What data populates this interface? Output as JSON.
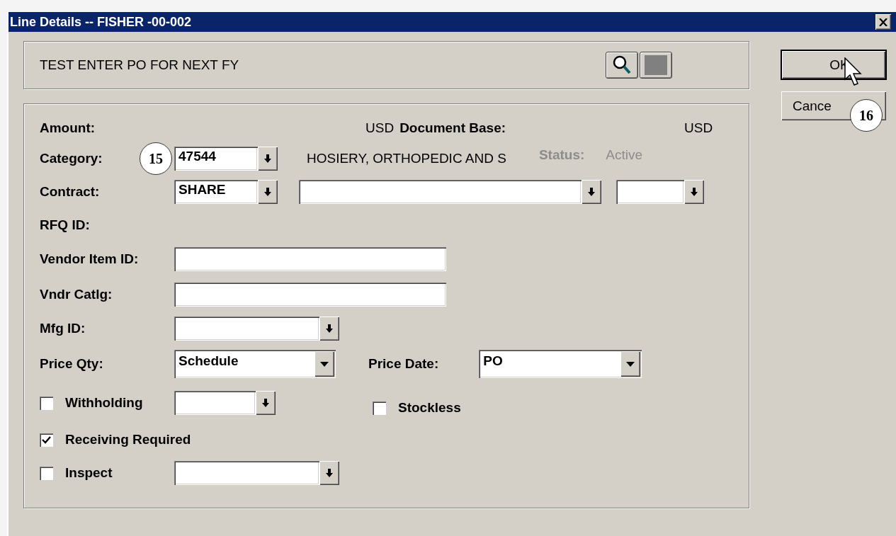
{
  "window": {
    "title": "Line Details -- FISHER -00-002"
  },
  "description": {
    "text": "TEST ENTER PO FOR NEXT FY"
  },
  "amount": {
    "label": "Amount:",
    "currency": "USD",
    "base_label": "Document Base:",
    "base_currency": "USD"
  },
  "category": {
    "label": "Category:",
    "callout": "15",
    "value": "47544",
    "description": "HOSIERY, ORTHOPEDIC AND S",
    "status_label": "Status:",
    "status": "Active"
  },
  "contract": {
    "label": "Contract:",
    "value": "SHARE"
  },
  "rfq": {
    "label": "RFQ ID:"
  },
  "vendor_item": {
    "label": "Vendor Item ID:"
  },
  "vendor_catalog": {
    "label": "Vndr Catlg:"
  },
  "mfg": {
    "label": "Mfg ID:"
  },
  "price_qty": {
    "label": "Price Qty:",
    "value": "Schedule"
  },
  "price_date": {
    "label": "Price Date:",
    "value": "PO"
  },
  "withholding": {
    "label": "Withholding",
    "checked": false
  },
  "stockless": {
    "label": "Stockless",
    "checked": false
  },
  "receiving": {
    "label": "Receiving Required",
    "checked": true
  },
  "inspect": {
    "label": "Inspect",
    "checked": false
  },
  "buttons": [
    {
      "label": "OK",
      "focused": true
    },
    {
      "label": "Cance",
      "focused": false
    }
  ],
  "callout": {
    "text": "16"
  }
}
